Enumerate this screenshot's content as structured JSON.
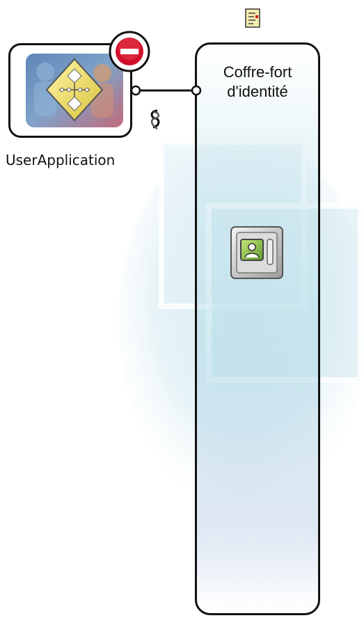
{
  "driver": {
    "label": "UserApplication",
    "status": "stopped",
    "icon": "workflow-diamond-icon",
    "status_icon": "stop-icon"
  },
  "vault": {
    "title": "Coffre-fort\nd'identité",
    "icon": "identity-vault-icon"
  },
  "connection": {
    "icon": "link-icon"
  },
  "top_icon": "driver-set-document-icon",
  "colors": {
    "stop_red": "#d0102a",
    "outline": "#111111",
    "vault_blue": "#b4dce8"
  }
}
